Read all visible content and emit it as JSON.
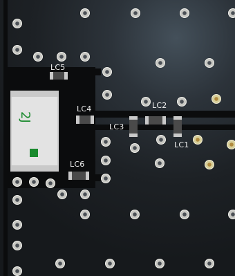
{
  "labels": {
    "lc1": "LC1",
    "lc2": "LC2",
    "lc3": "LC3",
    "lc4": "LC4",
    "lc5": "LC5",
    "lc6": "LC6",
    "component": "2J"
  },
  "colors": {
    "board": "#16191c",
    "trace": "#0b0c0d",
    "silkscreen": "#f2f2f2",
    "component_body": "#e3e3e3",
    "component_marking": "#1a8a2e"
  }
}
